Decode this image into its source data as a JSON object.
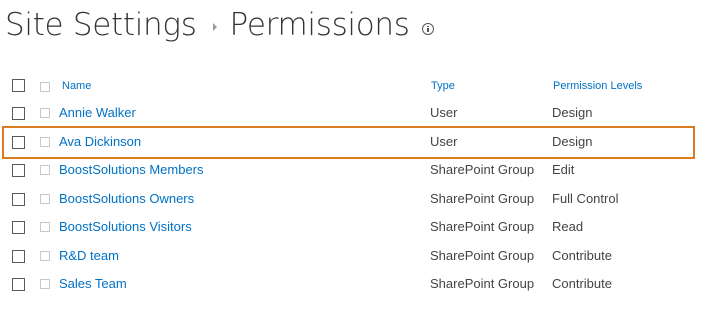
{
  "breadcrumb": {
    "root": "Site Settings",
    "current": "Permissions"
  },
  "table": {
    "headers": {
      "name": "Name",
      "type": "Type",
      "permission_levels": "Permission Levels"
    },
    "rows": [
      {
        "name": "Annie Walker",
        "type": "User",
        "permission": "Design"
      },
      {
        "name": "Ava Dickinson",
        "type": "User",
        "permission": "Design"
      },
      {
        "name": "BoostSolutions Members",
        "type": "SharePoint Group",
        "permission": "Edit"
      },
      {
        "name": "BoostSolutions Owners",
        "type": "SharePoint Group",
        "permission": "Full Control"
      },
      {
        "name": "BoostSolutions Visitors",
        "type": "SharePoint Group",
        "permission": "Read"
      },
      {
        "name": "R&D team",
        "type": "SharePoint Group",
        "permission": "Contribute"
      },
      {
        "name": "Sales Team",
        "type": "SharePoint Group",
        "permission": "Contribute"
      }
    ]
  },
  "colors": {
    "link": "#0072c6",
    "text": "#444444",
    "highlight_border": "#d97b1e"
  },
  "icons": {
    "info": "info-icon",
    "separator": "breadcrumb-arrow-icon"
  }
}
